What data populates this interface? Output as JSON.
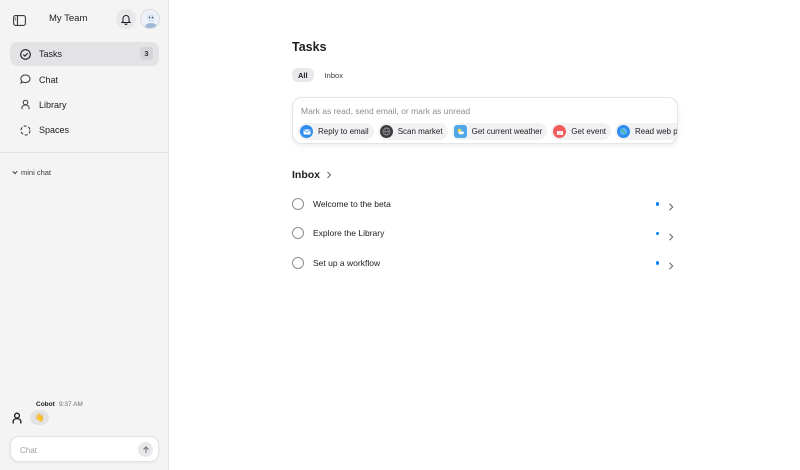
{
  "header": {
    "team_name": "My Team"
  },
  "sidebar": {
    "items": [
      {
        "label": "Tasks",
        "badge": "3",
        "icon": "check-circle-icon",
        "active": true
      },
      {
        "label": "Chat",
        "icon": "speech-bubble-icon"
      },
      {
        "label": "Library",
        "icon": "person-icon"
      },
      {
        "label": "Spaces",
        "icon": "dashed-circle-icon"
      }
    ],
    "mini_chat_label": "mini chat",
    "chat": {
      "sender": "Cobot",
      "time": "9:37 AM",
      "message_emoji": "👋"
    },
    "chat_input_placeholder": "Chat"
  },
  "main": {
    "title": "Tasks",
    "tabs": [
      {
        "label": "All",
        "active": true
      },
      {
        "label": "Inbox",
        "active": false
      }
    ],
    "command_placeholder": "Mark as read, send email, or mark as unread",
    "chips": [
      {
        "label": "Reply to email",
        "icon": "mail-icon",
        "color": "#2d8cf0"
      },
      {
        "label": "Scan market",
        "icon": "globe-dark-icon",
        "color": "#3a3a3c"
      },
      {
        "label": "Get current weather",
        "icon": "weather-icon",
        "color": "#4fa8e8"
      },
      {
        "label": "Get event",
        "icon": "calendar-icon",
        "color": "#f25c5c"
      },
      {
        "label": "Read web page",
        "icon": "globe-icon",
        "color": "#2d8cf0"
      }
    ],
    "inbox_title": "Inbox",
    "tasks": [
      {
        "label": "Welcome to the beta"
      },
      {
        "label": "Explore the Library"
      },
      {
        "label": "Set up a workflow"
      }
    ]
  },
  "colors": {
    "accent": "#0a84ff",
    "sidebar_bg": "#f4f4f5"
  }
}
